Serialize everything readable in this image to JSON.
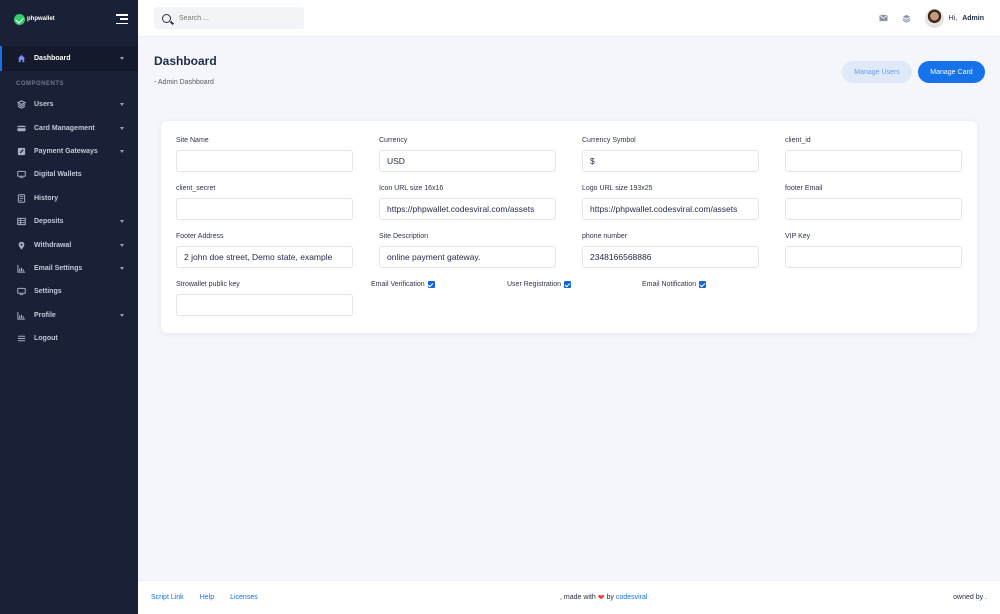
{
  "brand": {
    "name": "phpwallet"
  },
  "sidebar": {
    "active": {
      "label": "Dashboard",
      "icon": "home-icon"
    },
    "section_title": "COMPONENTS",
    "items": [
      {
        "label": "Users",
        "icon": "layers-icon",
        "caret": true
      },
      {
        "label": "Card Management",
        "icon": "card-icon",
        "caret": true
      },
      {
        "label": "Payment Gateways",
        "icon": "pencil-square-icon",
        "caret": true
      },
      {
        "label": "Digital Wallets",
        "icon": "desktop-icon",
        "caret": false
      },
      {
        "label": "History",
        "icon": "history-icon",
        "caret": false
      },
      {
        "label": "Deposits",
        "icon": "table-icon",
        "caret": true
      },
      {
        "label": "Withdrawal",
        "icon": "map-marker-icon",
        "caret": true
      },
      {
        "label": "Email Settings",
        "icon": "chart-icon",
        "caret": true
      },
      {
        "label": "Settings",
        "icon": "desktop-icon",
        "caret": false
      },
      {
        "label": "Profile",
        "icon": "chart-icon",
        "caret": true
      },
      {
        "label": "Logout",
        "icon": "list-icon",
        "caret": false
      }
    ]
  },
  "header": {
    "search_placeholder": "Search ...",
    "greeting": "Hi,",
    "user_name": "Admin"
  },
  "main": {
    "title": "Dashboard",
    "breadcrumb": "- Admin Dashboard",
    "manage_users": "Manage Users",
    "manage_card": "Manage Card"
  },
  "form": {
    "site_name": {
      "label": "Site Name",
      "value": ""
    },
    "currency": {
      "label": "Currency",
      "value": "USD"
    },
    "currency_symbol": {
      "label": "Currency Symbol",
      "value": "$"
    },
    "client_id": {
      "label": "client_id",
      "value": ""
    },
    "client_secret": {
      "label": "client_secret",
      "value": ""
    },
    "icon_url": {
      "label": "Icon URL size 16x16",
      "value": "https://phpwallet.codesviral.com/assets"
    },
    "logo_url": {
      "label": "Logo URL size 193x25",
      "value": "https://phpwallet.codesviral.com/assets"
    },
    "footer_email": {
      "label": "footer Email",
      "value": ""
    },
    "footer_address": {
      "label": "Footer Address",
      "value": "2 john doe street, Demo state, example"
    },
    "site_description": {
      "label": "Site Description",
      "value": "online payment gateway."
    },
    "phone_number": {
      "label": "phone number",
      "value": "2348166568886"
    },
    "vip_key": {
      "label": "VIP Key",
      "value": ""
    },
    "strowallet_key": {
      "label": "Strowallet public key",
      "value": ""
    },
    "email_verification": {
      "label": "Email Verification",
      "checked": true
    },
    "user_registration": {
      "label": "User Registration",
      "checked": true
    },
    "email_notification": {
      "label": "Email Notification",
      "checked": true
    }
  },
  "footer": {
    "links": [
      "Script Link",
      "Help",
      "Licenses"
    ],
    "made_with": ", made with",
    "by": "by",
    "author": "codesviral",
    "owned_by": "owned by ."
  },
  "colors": {
    "sidebar": "#1a2035",
    "primary": "#1572e8",
    "accent_green": "#31ce6b"
  }
}
